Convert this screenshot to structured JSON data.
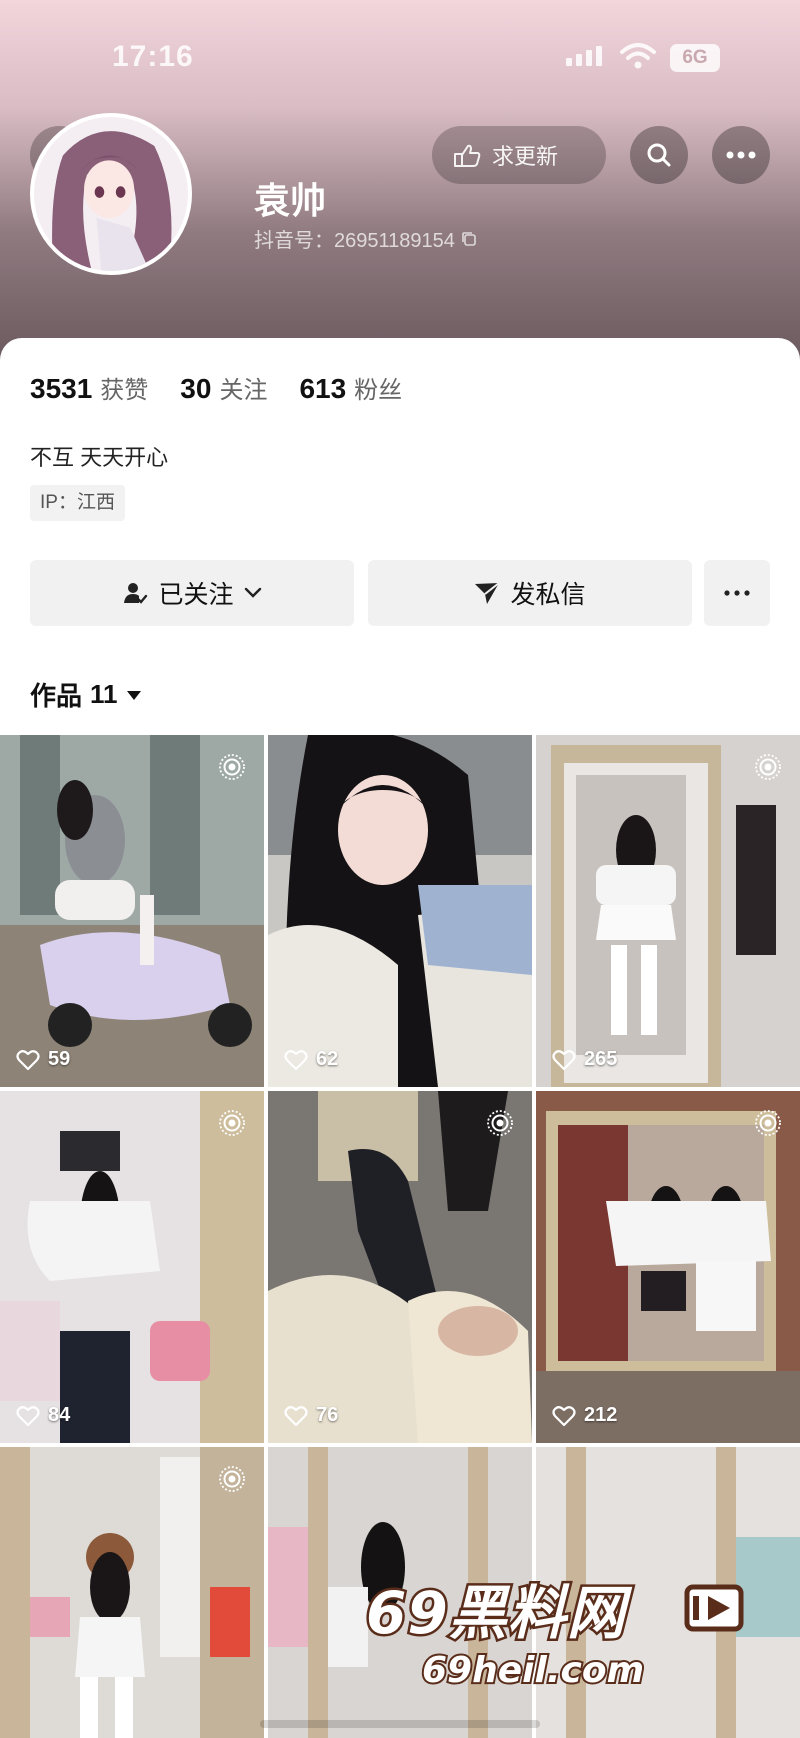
{
  "status_bar": {
    "time": "17:16",
    "network": "6G"
  },
  "header": {
    "update_label": "求更新",
    "username": "袁帅",
    "douyin_id": "抖音号：26951189154"
  },
  "stats": {
    "likes_num": "3531",
    "likes_label": "获赞",
    "following_num": "30",
    "following_label": "关注",
    "fans_num": "613",
    "fans_label": "粉丝"
  },
  "profile": {
    "bio": "不互 天天开心",
    "ip": "IP：江西"
  },
  "actions": {
    "follow_label": "已关注",
    "message_label": "发私信"
  },
  "works": {
    "label": "作品",
    "count": "11"
  },
  "posts": [
    {
      "likes": "59"
    },
    {
      "likes": "62"
    },
    {
      "likes": "265"
    },
    {
      "likes": "84"
    },
    {
      "likes": "76"
    },
    {
      "likes": "212"
    },
    {
      "likes": ""
    },
    {
      "likes": ""
    },
    {
      "likes": ""
    }
  ],
  "watermark": {
    "line1": "69黑料网",
    "line2": "69heil.com"
  },
  "colors": {
    "header_top": "#f2d6dc",
    "header_bottom": "#6b5a5f",
    "button_bg": "#f1f1f2"
  }
}
